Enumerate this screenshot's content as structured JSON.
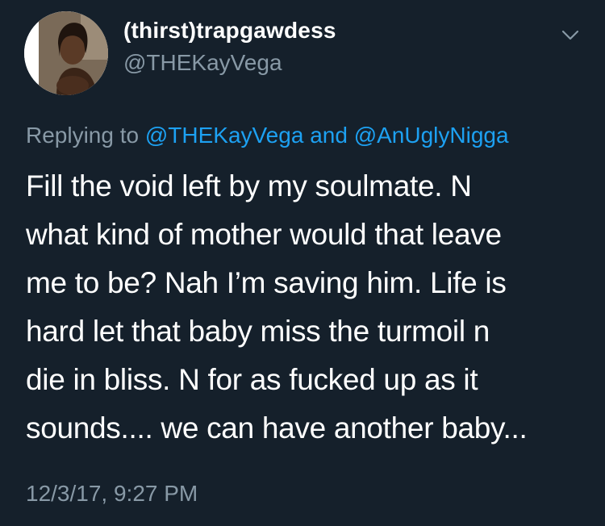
{
  "author": {
    "display_name": "(thirst)trapgawdess",
    "handle": "@THEKayVega",
    "avatar_icon": "profile-photo"
  },
  "menu_icon": "chevron-down-icon",
  "reply_context": {
    "prefix": "Replying to",
    "mention_1": "@THEKayVega",
    "joiner": "and",
    "mention_2": "@AnUglyNigga"
  },
  "tweet": {
    "text": "Fill the void left by my soulmate. N\nwhat kind of mother would that leave\nme to be? Nah I’m saving him. Life is\nhard let that baby miss the turmoil n\ndie in bliss. N for as fucked up as it\nsounds.... we can have another baby...",
    "timestamp": "12/3/17, 9:27 PM"
  },
  "colors": {
    "background": "#15202b",
    "primary_text": "#ffffff",
    "secondary_text": "#8899a6",
    "link": "#1da1f2"
  }
}
